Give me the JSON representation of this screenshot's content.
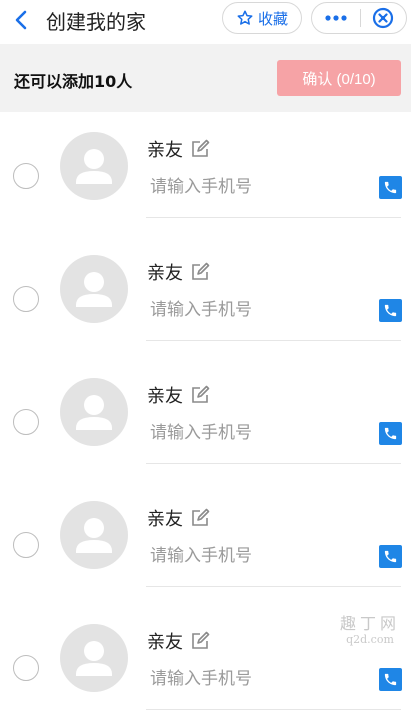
{
  "header": {
    "title": "创建我的家",
    "favorite_label": "收藏",
    "back_icon": "chevron-left-icon",
    "more_icon": "more-dots-icon",
    "close_icon": "close-circle-icon"
  },
  "subbar": {
    "info": "还可以添加10人",
    "confirm_label": "确认 (0/10)"
  },
  "contacts": [
    {
      "name": "亲友",
      "phone_placeholder": "请输入手机号"
    },
    {
      "name": "亲友",
      "phone_placeholder": "请输入手机号"
    },
    {
      "name": "亲友",
      "phone_placeholder": "请输入手机号"
    },
    {
      "name": "亲友",
      "phone_placeholder": "请输入手机号"
    },
    {
      "name": "亲友",
      "phone_placeholder": "请输入手机号"
    }
  ],
  "watermark": {
    "line1": "趣丁网",
    "line2": "q2d.com"
  },
  "colors": {
    "accent": "#1a6fe8",
    "confirm_disabled": "#f6a3a6",
    "phone_button": "#1f86e6",
    "subbar_bg": "#f2f2f2",
    "avatar_bg": "#e3e3e3"
  }
}
